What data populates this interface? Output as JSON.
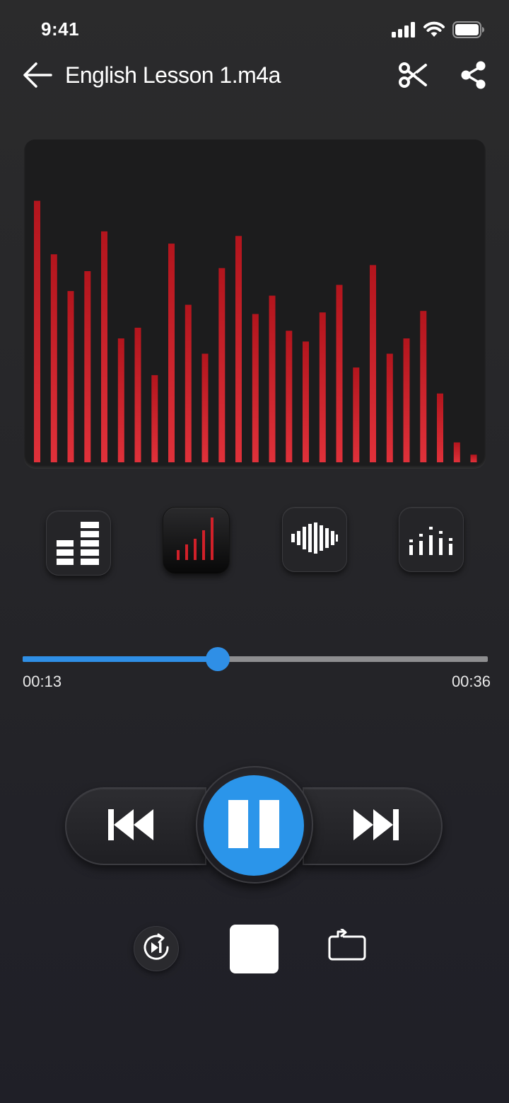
{
  "status_bar": {
    "time": "9:41",
    "icons": [
      "cellular-signal-icon",
      "wifi-icon",
      "battery-icon"
    ]
  },
  "header": {
    "title": "English Lesson 1.m4a",
    "back_icon": "arrow-left-icon",
    "trim_icon": "scissors-icon",
    "share_icon": "share-icon"
  },
  "visualizer": {
    "style": "bars",
    "colors": {
      "bar_bottom": "#e0313a",
      "bar_top": "#b3151d",
      "background": "#1c1c1d"
    },
    "levels": [
      0.855,
      0.68,
      0.56,
      0.625,
      0.755,
      0.405,
      0.44,
      0.285,
      0.715,
      0.515,
      0.355,
      0.635,
      0.74,
      0.485,
      0.545,
      0.43,
      0.395,
      0.49,
      0.58,
      0.31,
      0.645,
      0.355,
      0.405,
      0.495,
      0.225,
      0.065,
      0.025
    ]
  },
  "visualizer_styles": [
    {
      "name": "stacked-blocks",
      "icon": "stacked-bars-icon",
      "active": false
    },
    {
      "name": "rising-bars",
      "icon": "rising-bars-icon",
      "active": true
    },
    {
      "name": "waveform",
      "icon": "waveform-icon",
      "active": false
    },
    {
      "name": "dotted-bars",
      "icon": "dotted-bars-icon",
      "active": false
    }
  ],
  "playback": {
    "elapsed": "00:13",
    "total": "00:36",
    "progress": 0.42,
    "accent_color": "#2b95ea",
    "state": "playing"
  },
  "controls": {
    "previous_icon": "skip-previous-icon",
    "pause_icon": "pause-icon",
    "next_icon": "skip-next-icon",
    "speed_icon": "playback-speed-icon",
    "stop_icon": "stop-icon",
    "repeat_icon": "repeat-icon"
  }
}
